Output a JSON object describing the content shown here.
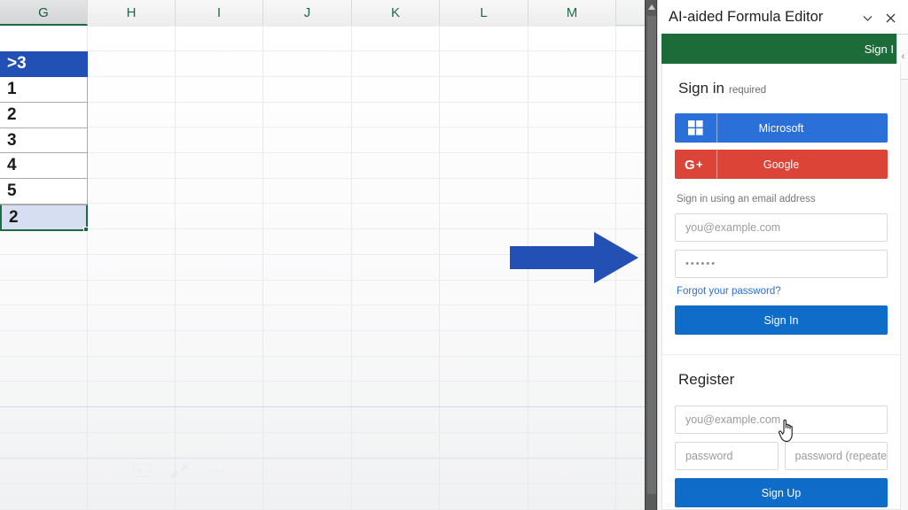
{
  "spreadsheet": {
    "columns": [
      "G",
      "H",
      "I",
      "J",
      "K",
      "L",
      "M"
    ],
    "active_column": "G",
    "column_g_cells": [
      {
        "value": "",
        "state": "blank"
      },
      {
        "value": ">3",
        "state": "header-selected"
      },
      {
        "value": "1",
        "state": "normal"
      },
      {
        "value": "2",
        "state": "normal"
      },
      {
        "value": "3",
        "state": "normal"
      },
      {
        "value": "4",
        "state": "normal"
      },
      {
        "value": "5",
        "state": "normal"
      },
      {
        "value": "2",
        "state": "selected"
      }
    ],
    "arrow": {
      "direction": "right",
      "color": "#2250b4"
    }
  },
  "pane": {
    "title": "AI-aided Formula Editor",
    "collapse_icon": "chevron-down-icon",
    "close_icon": "close-icon",
    "green_bar": {
      "label": "Sign I",
      "color": "#1e6b3a"
    },
    "side_tab_icon": "‹",
    "signin": {
      "heading": "Sign in",
      "heading_note": "required",
      "microsoft_button": "Microsoft",
      "microsoft_color": "#2b6fd8",
      "google_button": "Google",
      "google_color": "#dc4437",
      "email_hint": "Sign in using an email address",
      "email_placeholder": "you@example.com",
      "password_value": "••••••",
      "forgot_link": "Forgot your password?",
      "submit_button": "Sign In",
      "submit_color": "#0f6cc9"
    },
    "register": {
      "heading": "Register",
      "email_placeholder": "you@example.com",
      "password_placeholder": "password",
      "password_repeat_placeholder": "password (repeated)",
      "submit_button": "Sign Up",
      "submit_color": "#0f6cc9"
    }
  }
}
